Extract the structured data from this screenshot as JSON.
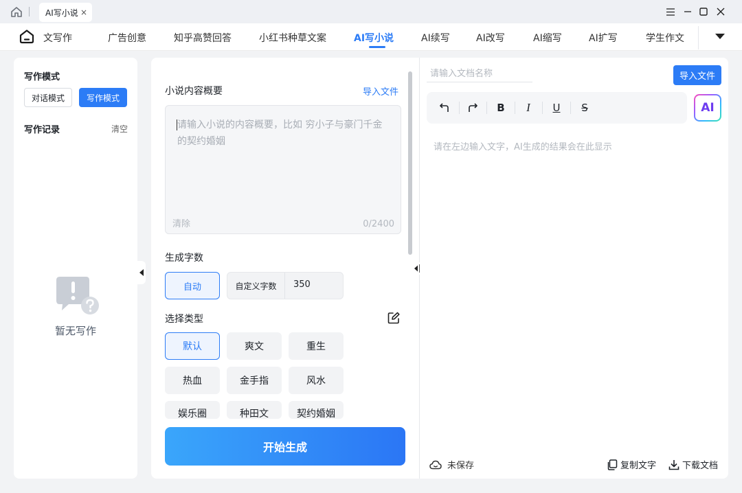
{
  "window": {
    "tab_title": "AI写小说",
    "tab_close": "×"
  },
  "nav": {
    "items": [
      {
        "label": "论文写作"
      },
      {
        "label": "广告创意"
      },
      {
        "label": "知乎高赞回答"
      },
      {
        "label": "小红书种草文案"
      },
      {
        "label": "AI写小说"
      },
      {
        "label": "AI续写"
      },
      {
        "label": "AI改写"
      },
      {
        "label": "AI缩写"
      },
      {
        "label": "AI扩写"
      },
      {
        "label": "学生作文"
      }
    ],
    "active_index": 4
  },
  "sidebar": {
    "mode_title": "写作模式",
    "mode_chat": "对话模式",
    "mode_write": "写作模式",
    "record_title": "写作记录",
    "clear": "清空",
    "empty_text": "暂无写作"
  },
  "main": {
    "summary_label": "小说内容概要",
    "import_file": "导入文件",
    "summary_placeholder": "请输入小说的内容概要，比如 穷小子与豪门千金的契约婚姻",
    "clear": "清除",
    "char_count": "0/2400",
    "word_count_label": "生成字数",
    "auto": "自动",
    "custom_label": "自定义字数",
    "custom_value": "350",
    "genre_label": "选择类型",
    "genres": [
      "默认",
      "爽文",
      "重生",
      "热血",
      "金手指",
      "风水",
      "娱乐圈",
      "种田文",
      "契约婚姻"
    ],
    "selected_genre_index": 0,
    "start_button": "开始生成"
  },
  "editor": {
    "doc_name_placeholder": "请输入文档名称",
    "import_button": "导入文件",
    "tools": [
      {
        "icon": "undo-icon",
        "glyph": "↰"
      },
      {
        "icon": "redo-icon",
        "glyph": "↱"
      },
      {
        "icon": "bold-icon",
        "glyph": "B"
      },
      {
        "icon": "italic-icon",
        "glyph": "I"
      },
      {
        "icon": "underline-icon",
        "glyph": "U"
      },
      {
        "icon": "strikethrough-icon",
        "glyph": "S"
      }
    ],
    "ai_badge": "AI",
    "placeholder": "请在左边输入文字，AI生成的结果会在此显示",
    "unsaved": "未保存",
    "copy_text": "复制文字",
    "download_doc": "下载文档"
  },
  "colors": {
    "accent": "#2c7cf6",
    "background": "#f2f3f5"
  }
}
